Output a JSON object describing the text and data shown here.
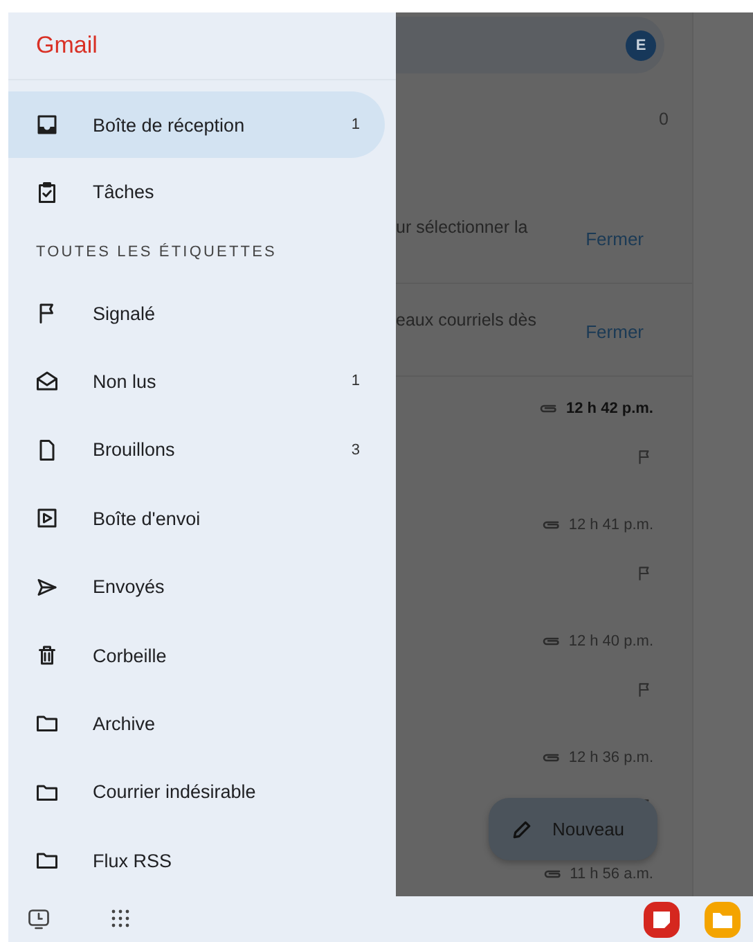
{
  "drawer": {
    "title": "Gmail",
    "top_items": [
      {
        "kind": "inbox",
        "label": "Boîte de réception",
        "count": "1",
        "selected": true
      },
      {
        "kind": "tasks",
        "label": "Tâches",
        "selected": false
      }
    ],
    "section_header": "TOUTES LES ÉTIQUETTES",
    "labels": [
      {
        "kind": "flag",
        "label": "Signalé",
        "selected": false
      },
      {
        "kind": "mail-open",
        "label": "Non lus",
        "count": "1",
        "selected": false
      },
      {
        "kind": "file",
        "label": "Brouillons",
        "count": "3",
        "selected": false
      },
      {
        "kind": "outbox",
        "label": "Boîte d'envoi",
        "selected": false
      },
      {
        "kind": "send",
        "label": "Envoyés",
        "selected": false
      },
      {
        "kind": "trash",
        "label": "Corbeille",
        "selected": false
      },
      {
        "kind": "folder",
        "label": "Archive",
        "selected": false
      },
      {
        "kind": "folder",
        "label": "Courrier indésirable",
        "selected": false
      },
      {
        "kind": "folder",
        "label": "Flux RSS",
        "selected": false
      }
    ]
  },
  "mail_list": {
    "avatar_letter": "E",
    "count": "0",
    "banners": [
      {
        "text": "ur sélectionner la",
        "action": "Fermer"
      },
      {
        "text": "eaux courriels dès",
        "action": "Fermer"
      }
    ],
    "messages": [
      {
        "time": "12 h 42 p.m.",
        "unread": true
      },
      {
        "time": "12 h 41 p.m.",
        "unread": false
      },
      {
        "time": "12 h 40 p.m.",
        "unread": false
      },
      {
        "time": "12 h 36 p.m.",
        "unread": false
      },
      {
        "time": "11 h 56 a.m.",
        "unread": false
      }
    ],
    "compose_button": "Nouveau"
  }
}
